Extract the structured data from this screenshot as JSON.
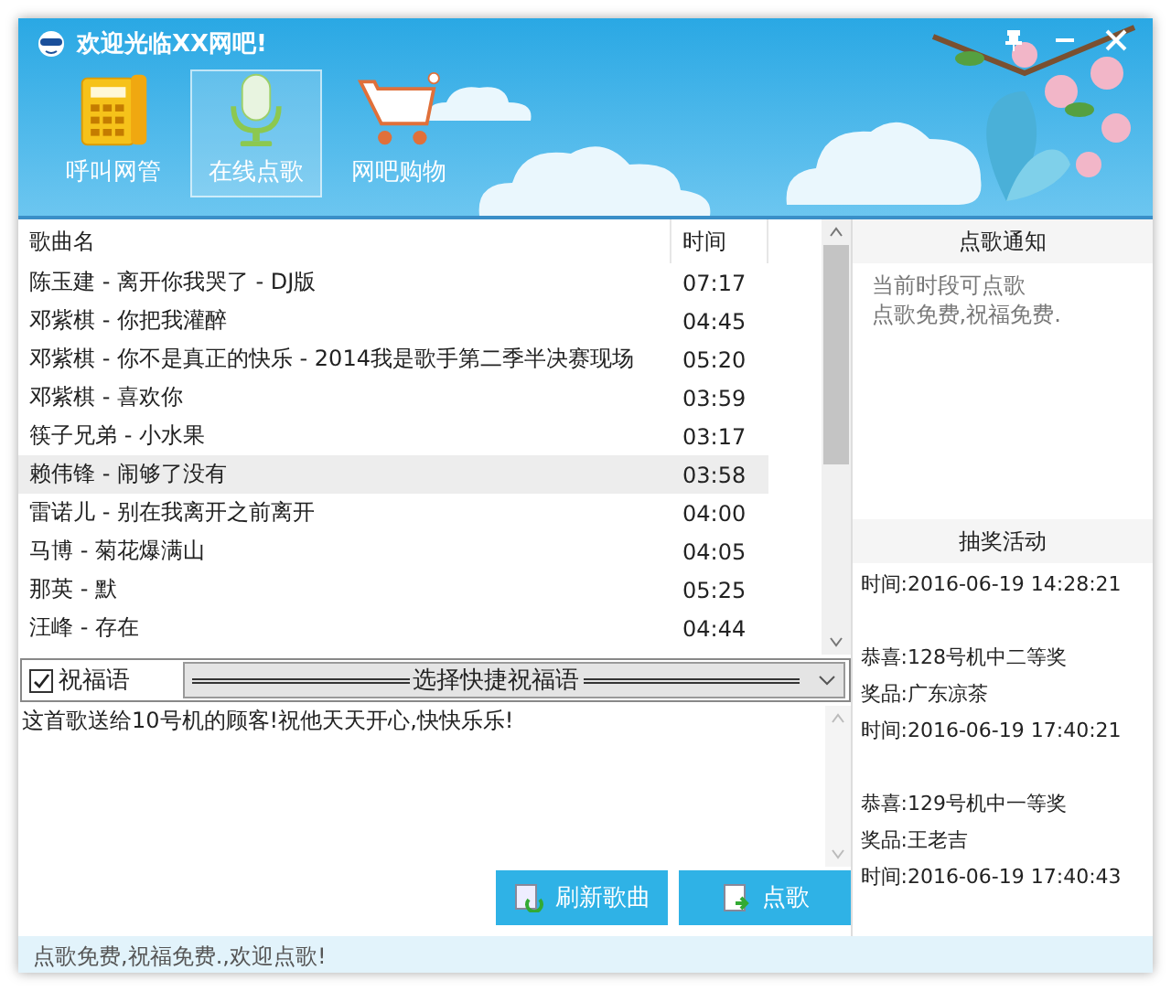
{
  "window": {
    "title": "欢迎光临XX网吧!"
  },
  "nav": [
    {
      "label": "呼叫网管",
      "kind": "phone",
      "selected": false
    },
    {
      "label": "在线点歌",
      "kind": "mic",
      "selected": true
    },
    {
      "label": "网吧购物",
      "kind": "cart",
      "selected": false
    }
  ],
  "song_table": {
    "columns": [
      "歌曲名",
      "时间"
    ],
    "rows": [
      {
        "name": "陈玉建 - 离开你我哭了 - DJ版",
        "time": "07:17",
        "selected": false
      },
      {
        "name": "邓紫棋 - 你把我灌醉",
        "time": "04:45",
        "selected": false
      },
      {
        "name": "邓紫棋 - 你不是真正的快乐 - 2014我是歌手第二季半决赛现场",
        "time": "05:20",
        "selected": false
      },
      {
        "name": "邓紫棋 - 喜欢你",
        "time": "03:59",
        "selected": false
      },
      {
        "name": "筷子兄弟 - 小水果",
        "time": "03:17",
        "selected": false
      },
      {
        "name": "赖伟锋 - 闹够了没有",
        "time": "03:58",
        "selected": true
      },
      {
        "name": "雷诺儿 - 别在我离开之前离开",
        "time": "04:00",
        "selected": false
      },
      {
        "name": "马博 - 菊花爆满山",
        "time": "04:05",
        "selected": false
      },
      {
        "name": "那英 - 默",
        "time": "05:25",
        "selected": false
      },
      {
        "name": "汪峰 - 存在",
        "time": "04:44",
        "selected": false
      }
    ]
  },
  "greeting": {
    "label": "祝福语",
    "checked": true,
    "dropdown": "选择快捷祝福语",
    "message": "这首歌送给10号机的顾客!祝他天天开心,快快乐乐!"
  },
  "buttons": [
    {
      "label": "刷新歌曲",
      "kind": "refresh"
    },
    {
      "label": "点歌",
      "kind": "request"
    }
  ],
  "notice": {
    "title": "点歌通知",
    "lines": [
      "当前时段可点歌",
      "点歌免费,祝福免费."
    ]
  },
  "lottery": {
    "title": "抽奖活动",
    "groups": [
      [
        "时间:2016-06-19 14:28:21"
      ],
      [
        "恭喜:128号机中二等奖",
        "奖品:广东凉茶",
        "时间:2016-06-19 17:40:21"
      ],
      [
        "恭喜:129号机中一等奖",
        "奖品:王老吉",
        "时间:2016-06-19 17:40:43"
      ]
    ]
  },
  "status_bar": "点歌免费,祝福免费.,欢迎点歌!"
}
